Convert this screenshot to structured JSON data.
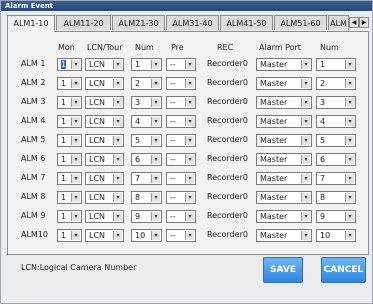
{
  "window": {
    "title": "Alarm Event"
  },
  "tabs": [
    "ALM1-10",
    "ALM11-20",
    "ALM21-30",
    "ALM31-40",
    "ALM41-50",
    "ALM51-60",
    "ALM"
  ],
  "columns": {
    "mon": "Mon",
    "lcn_tour": "LCN/Tour",
    "num": "Num",
    "pre": "Pre",
    "rec": "REC",
    "alarm_port": "Alarm Port",
    "num2": "Num"
  },
  "rows": [
    {
      "label": "ALM 1",
      "mon": "1",
      "lcn": "LCN",
      "num": "1",
      "pre": "--",
      "rec": "Recorder0",
      "port": "Master",
      "num2": "1"
    },
    {
      "label": "ALM 2",
      "mon": "1",
      "lcn": "LCN",
      "num": "2",
      "pre": "--",
      "rec": "Recorder0",
      "port": "Master",
      "num2": "2"
    },
    {
      "label": "ALM 3",
      "mon": "1",
      "lcn": "LCN",
      "num": "3",
      "pre": "--",
      "rec": "Recorder0",
      "port": "Master",
      "num2": "3"
    },
    {
      "label": "ALM 4",
      "mon": "1",
      "lcn": "LCN",
      "num": "4",
      "pre": "--",
      "rec": "Recorder0",
      "port": "Master",
      "num2": "4"
    },
    {
      "label": "ALM 5",
      "mon": "1",
      "lcn": "LCN",
      "num": "5",
      "pre": "--",
      "rec": "Recorder0",
      "port": "Master",
      "num2": "5"
    },
    {
      "label": "ALM 6",
      "mon": "1",
      "lcn": "LCN",
      "num": "6",
      "pre": "--",
      "rec": "Recorder0",
      "port": "Master",
      "num2": "6"
    },
    {
      "label": "ALM 7",
      "mon": "1",
      "lcn": "LCN",
      "num": "7",
      "pre": "--",
      "rec": "Recorder0",
      "port": "Master",
      "num2": "7"
    },
    {
      "label": "ALM 8",
      "mon": "1",
      "lcn": "LCN",
      "num": "8",
      "pre": "--",
      "rec": "Recorder0",
      "port": "Master",
      "num2": "8"
    },
    {
      "label": "ALM 9",
      "mon": "1",
      "lcn": "LCN",
      "num": "9",
      "pre": "--",
      "rec": "Recorder0",
      "port": "Master",
      "num2": "9"
    },
    {
      "label": "ALM10",
      "mon": "1",
      "lcn": "LCN",
      "num": "10",
      "pre": "--",
      "rec": "Recorder0",
      "port": "Master",
      "num2": "10"
    }
  ],
  "footer_note": "LCN:Logical Camera Number",
  "buttons": {
    "save": "SAVE",
    "cancel": "CANCEL"
  },
  "colors": {
    "title_bar": "#26487a",
    "button": "#3a8fe6",
    "selection": "#2f5fc4"
  }
}
